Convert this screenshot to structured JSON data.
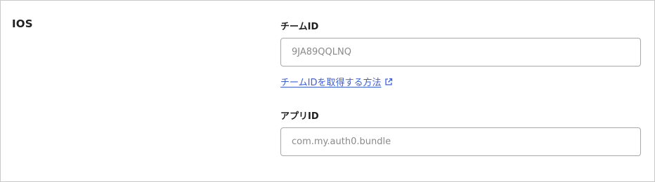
{
  "section": {
    "title": "IOS"
  },
  "team_id": {
    "label": "チームID",
    "placeholder": "9JA89QQLNQ",
    "value": "",
    "help_link_label": "チームIDを取得する方法",
    "help_link_icon": "external-link-icon"
  },
  "app_id": {
    "label": "アプリID",
    "placeholder": "com.my.auth0.bundle",
    "value": ""
  },
  "colors": {
    "link": "#3b5ee0",
    "border": "#a8a8a8",
    "panel_border": "#c9c9c9",
    "placeholder": "#8a8a8a",
    "text": "#1f1f1f"
  }
}
